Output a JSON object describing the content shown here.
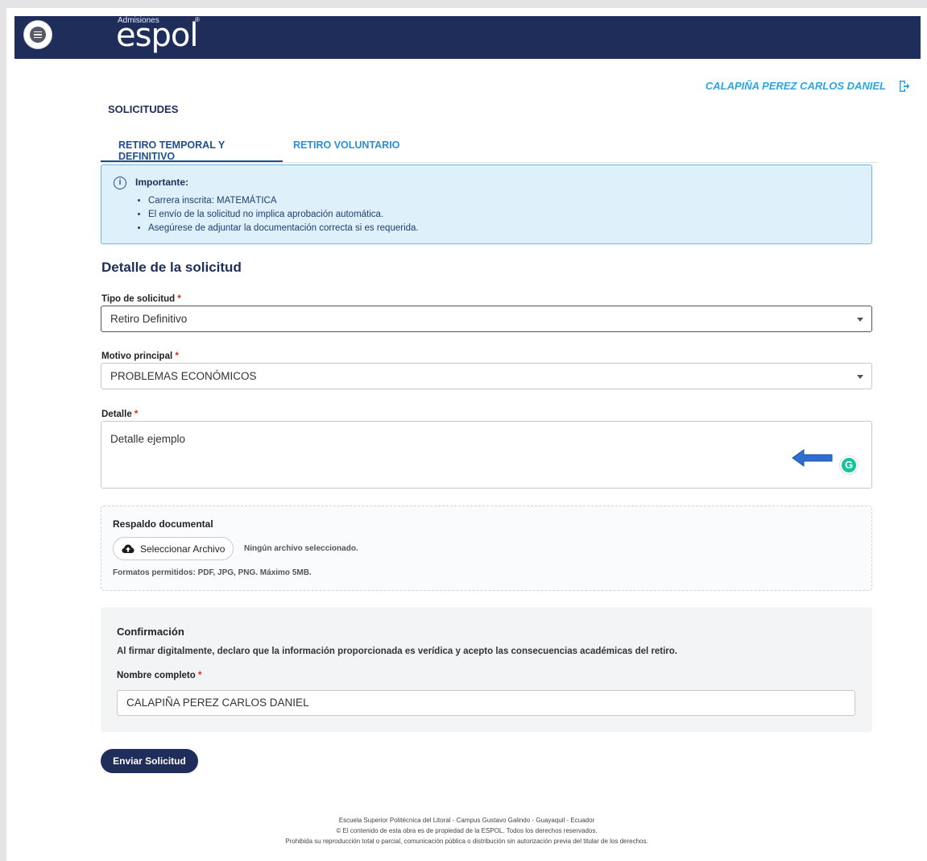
{
  "header": {
    "logo_small": "Admisiones",
    "logo_text": "espol",
    "logo_reg": "®"
  },
  "user": {
    "name": "CALAPIÑA PEREZ CARLOS DANIEL"
  },
  "section_title": "SOLICITUDES",
  "tabs": [
    {
      "label": "RETIRO TEMPORAL Y DEFINITIVO",
      "active": true
    },
    {
      "label": "RETIRO VOLUNTARIO",
      "active": false
    }
  ],
  "info": {
    "icon": "info-icon",
    "title": "Importante:",
    "items": [
      "Carrera inscrita: MATEMÁTICA",
      "El envío de la solicitud no implica aprobación automática.",
      "Asegúrese de adjuntar la documentación correcta si es requerida."
    ]
  },
  "detail": {
    "title": "Detalle de la solicitud",
    "tipo_label": "Tipo de solicitud",
    "tipo_value": "Retiro Definitivo",
    "motivo_label": "Motivo principal",
    "motivo_value": "PROBLEMAS ECONÓMICOS",
    "detalle_label": "Detalle",
    "detalle_value": "Detalle ejemplo",
    "required_mark": "*"
  },
  "upload": {
    "title": "Respaldo documental",
    "button_label": "Seleccionar Archivo",
    "status": "Ningún archivo seleccionado.",
    "formats": "Formatos permitidos: PDF, JPG, PNG. Máximo 5MB."
  },
  "confirm": {
    "title": "Confirmación",
    "text": "Al firmar digitalmente, declaro que la información proporcionada es verídica y acepto las consecuencias académicas del retiro.",
    "name_label": "Nombre completo",
    "name_value": "CALAPIÑA PEREZ CARLOS DANIEL"
  },
  "submit_label": "Enviar Solicitud",
  "grammarly_letter": "G",
  "footer": {
    "line1": "Escuela Superior Politécnica del Litoral - Campus Gustavo Galindo - Guayaquil - Ecuador",
    "line2": "© El contenido de esta obra es de propiedad de la ESPOL. Todos los derechos reservados.",
    "line3": "Prohibida su reproducción total o parcial, comunicación pública o distribución sin autorización previa del titular de los derechos."
  },
  "colors": {
    "header_bg": "#1f2d5a",
    "accent_blue": "#28a7e6",
    "info_bg": "#def1fb",
    "required": "#e02424",
    "grammarly": "#15c39a",
    "annotation_arrow": "#2f6fd1"
  }
}
